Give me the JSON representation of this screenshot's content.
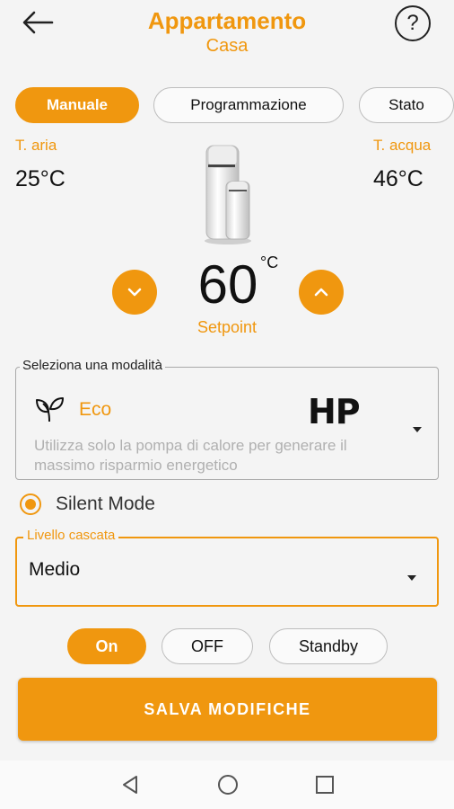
{
  "header": {
    "title": "Appartamento",
    "subtitle": "Casa",
    "help_symbol": "?"
  },
  "tabs": [
    {
      "label": "Manuale",
      "active": true
    },
    {
      "label": "Programmazione",
      "active": false
    },
    {
      "label": "Stato",
      "active": false
    }
  ],
  "temperatures": {
    "air": {
      "label": "T. aria",
      "value": "25°C"
    },
    "water": {
      "label": "T. acqua",
      "value": "46°C"
    }
  },
  "setpoint": {
    "value": "60",
    "unit": "°C",
    "label": "Setpoint"
  },
  "mode": {
    "legend": "Seleziona una modalità",
    "name": "Eco",
    "badge": "HP",
    "description": "Utilizza solo la pompa di calore per generare il massimo risparmio energetico",
    "icon": "leaf-icon"
  },
  "silent_mode": {
    "label": "Silent Mode",
    "selected": true
  },
  "cascade": {
    "legend": "Livello cascata",
    "value": "Medio"
  },
  "power": [
    {
      "label": "On",
      "active": true
    },
    {
      "label": "OFF",
      "active": false
    },
    {
      "label": "Standby",
      "active": false
    }
  ],
  "save_label": "SALVA MODIFICHE",
  "colors": {
    "accent": "#f0970f",
    "background": "#f4f4f4"
  },
  "nav_icons": [
    "back-triangle-icon",
    "home-circle-icon",
    "recents-square-icon"
  ]
}
